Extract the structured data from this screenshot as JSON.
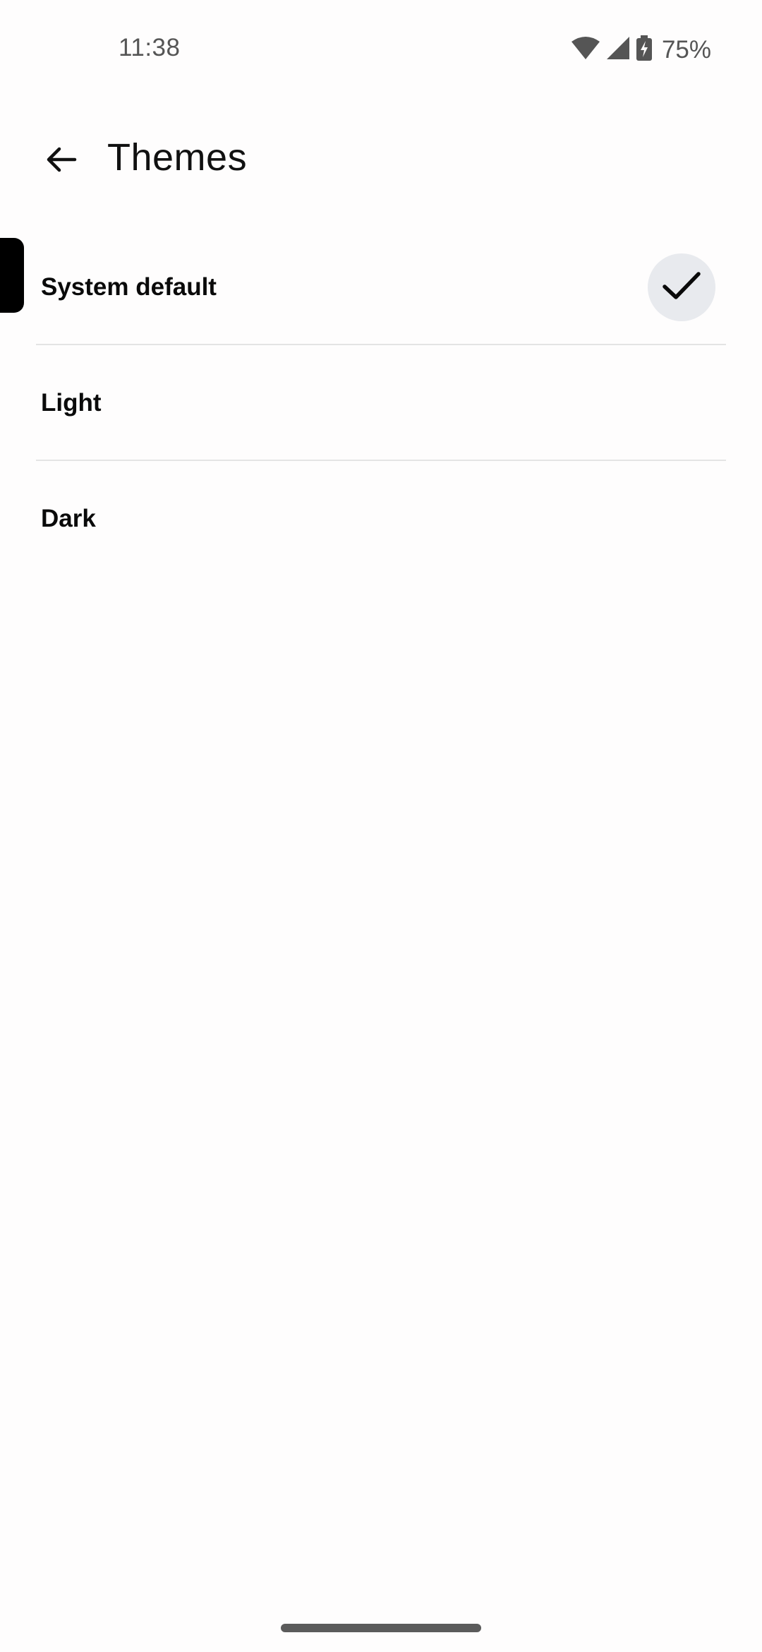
{
  "status_bar": {
    "time": "11:38",
    "battery": "75%",
    "icons": [
      "wifi-icon",
      "cell-signal-icon",
      "battery-charging-icon"
    ]
  },
  "app_bar": {
    "title": "Themes",
    "back_icon": "arrow-left-icon"
  },
  "themes": {
    "items": [
      {
        "label": "System default",
        "selected": true
      },
      {
        "label": "Light",
        "selected": false
      },
      {
        "label": "Dark",
        "selected": false
      }
    ],
    "selected_icon": "check-icon"
  },
  "colors": {
    "background": "#fefdfd",
    "check_badge": "#e8eaee",
    "divider": "#e4e4e4"
  }
}
